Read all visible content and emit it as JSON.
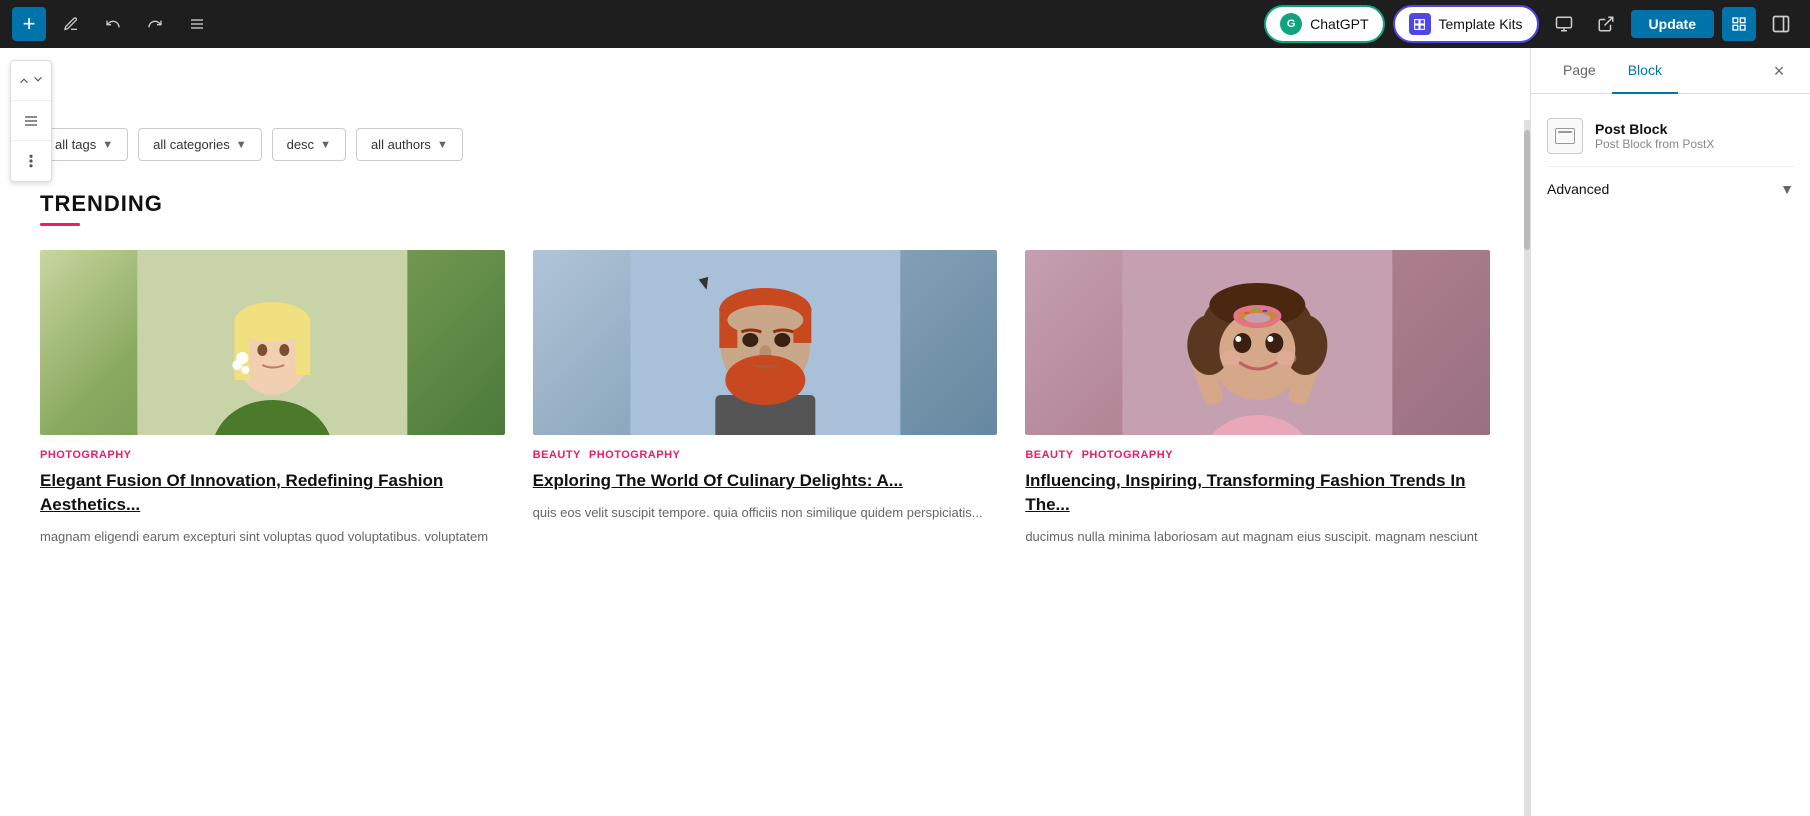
{
  "toolbar": {
    "add_label": "+",
    "pencil_label": "✏",
    "undo_label": "↩",
    "redo_label": "↪",
    "menu_label": "≡",
    "chatgpt_label": "ChatGPT",
    "templatekits_label": "Template Kits",
    "responsive_label": "□",
    "external_label": "⬡",
    "update_label": "Update",
    "grid_label": "⊞",
    "sidebar_label": "▣"
  },
  "float_toolbar": {
    "chevron_label": "⌄",
    "align_label": "☰",
    "more_label": "⋮"
  },
  "filters": {
    "tags_label": "all tags",
    "categories_label": "all categories",
    "order_label": "desc",
    "authors_label": "all authors"
  },
  "trending": {
    "title": "TRENDING",
    "posts": [
      {
        "categories": [
          "PHOTOGRAPHY"
        ],
        "title": "Elegant Fusion Of Innovation, Redefining Fashion Aesthetics...",
        "excerpt": "magnam eligendi earum excepturi sint voluptas quod voluptatibus. voluptatem"
      },
      {
        "categories": [
          "BEAUTY",
          "PHOTOGRAPHY"
        ],
        "title": "Exploring The World Of Culinary Delights: A...",
        "excerpt": "quis eos velit suscipit tempore. quia officiis non similique quidem perspiciatis..."
      },
      {
        "categories": [
          "BEAUTY",
          "PHOTOGRAPHY"
        ],
        "title": "Influencing, Inspiring, Transforming Fashion Trends In The...",
        "excerpt": "ducimus nulla minima laboriosam aut magnam eius suscipit. magnam nesciunt"
      }
    ]
  },
  "panel": {
    "page_tab": "Page",
    "block_tab": "Block",
    "block_name": "Post Block",
    "block_source": "Post Block from PostX",
    "advanced_label": "Advanced",
    "close_label": "×"
  }
}
